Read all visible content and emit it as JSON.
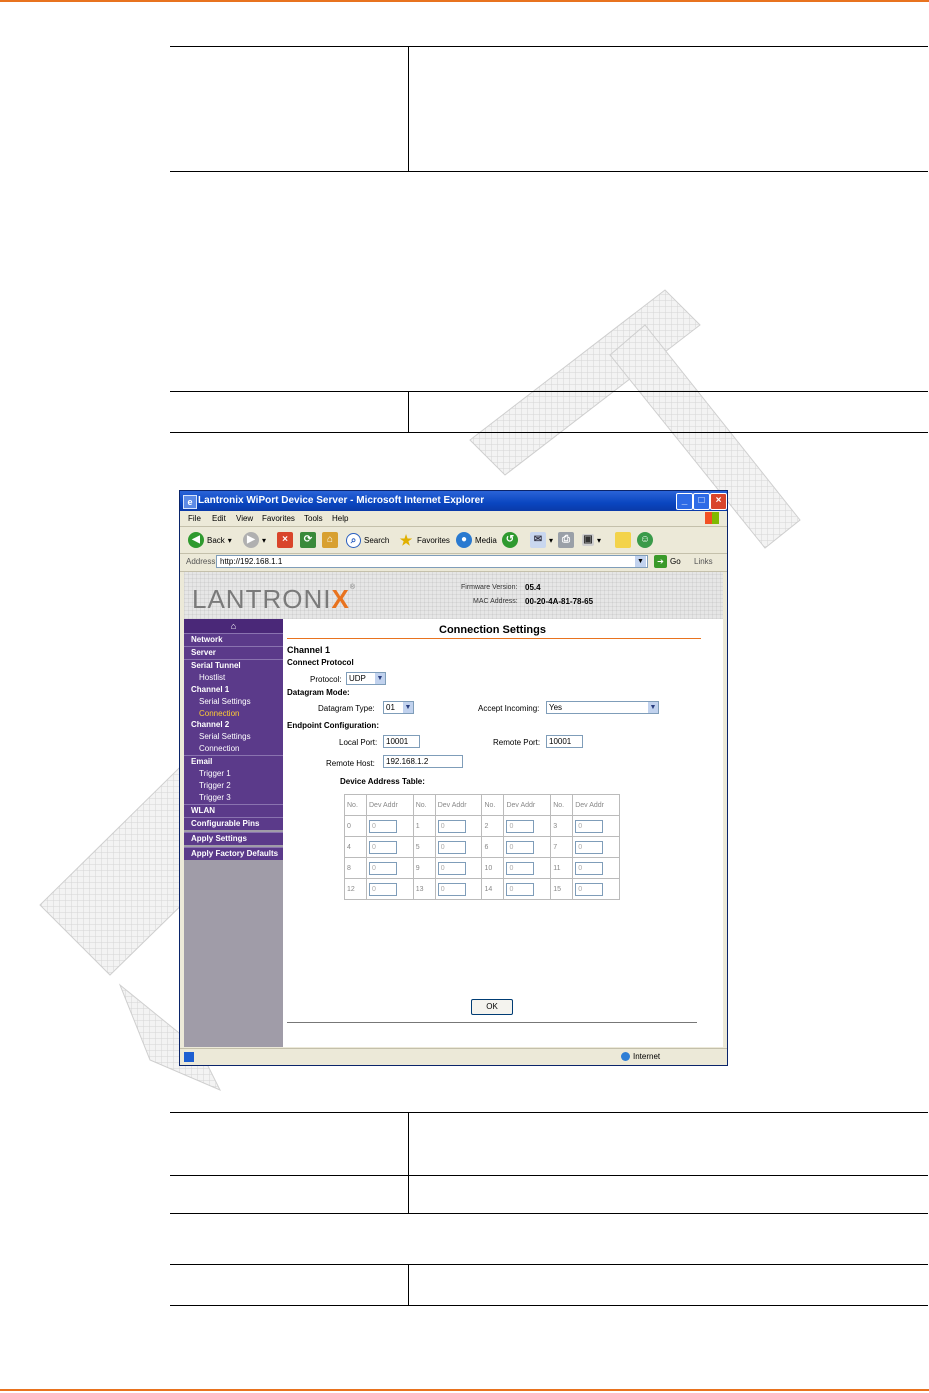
{
  "browser": {
    "title": "Lantronix WiPort Device Server - Microsoft Internet Explorer",
    "menu": [
      "File",
      "Edit",
      "View",
      "Favorites",
      "Tools",
      "Help"
    ],
    "toolbar": {
      "back": "Back",
      "search": "Search",
      "favorites": "Favorites",
      "media": "Media"
    },
    "address_label": "Address",
    "address": "http://192.168.1.1",
    "go": "Go",
    "links": "Links",
    "status_zone": "Internet"
  },
  "header": {
    "logo": "LANTRONI",
    "logo_x": "X",
    "firmware_label": "Firmware Version:",
    "firmware": "05.4",
    "mac_label": "MAC Address:",
    "mac": "00-20-4A-81-78-65"
  },
  "sidebar": {
    "network": "Network",
    "server": "Server",
    "serial_tunnel": "Serial Tunnel",
    "hostlist": "Hostlist",
    "channel1": "Channel 1",
    "ch1_serial": "Serial Settings",
    "ch1_connection": "Connection",
    "channel2": "Channel 2",
    "ch2_serial": "Serial Settings",
    "ch2_connection": "Connection",
    "email": "Email",
    "trigger1": "Trigger 1",
    "trigger2": "Trigger 2",
    "trigger3": "Trigger 3",
    "wlan": "WLAN",
    "configurable_pins": "Configurable Pins",
    "apply_settings": "Apply Settings",
    "apply_factory": "Apply Factory Defaults"
  },
  "main": {
    "title": "Connection Settings",
    "channel": "Channel 1",
    "connect_protocol": "Connect Protocol",
    "protocol_label": "Protocol:",
    "protocol_value": "UDP",
    "datagram_mode": "Datagram Mode:",
    "datagram_type_label": "Datagram Type:",
    "datagram_type_value": "01",
    "accept_incoming_label": "Accept Incoming:",
    "accept_incoming_value": "Yes",
    "endpoint_config": "Endpoint Configuration:",
    "local_port_label": "Local Port:",
    "local_port": "10001",
    "remote_port_label": "Remote Port:",
    "remote_port": "10001",
    "remote_host_label": "Remote Host:",
    "remote_host": "192.168.1.2",
    "dat_title": "Device Address Table:",
    "dat_headers": [
      "No.",
      "Dev Addr",
      "No.",
      "Dev Addr",
      "No.",
      "Dev Addr",
      "No.",
      "Dev Addr"
    ],
    "dat_rows": [
      [
        "0",
        "0",
        "1",
        "0",
        "2",
        "0",
        "3",
        "0"
      ],
      [
        "4",
        "0",
        "5",
        "0",
        "6",
        "0",
        "7",
        "0"
      ],
      [
        "8",
        "0",
        "9",
        "0",
        "10",
        "0",
        "11",
        "0"
      ],
      [
        "12",
        "0",
        "13",
        "0",
        "14",
        "0",
        "15",
        "0"
      ]
    ],
    "ok": "OK"
  },
  "colors": {
    "accent": "#e8731f",
    "sidebar": "#5b3a8a",
    "watermark": "#dcdcdc"
  }
}
